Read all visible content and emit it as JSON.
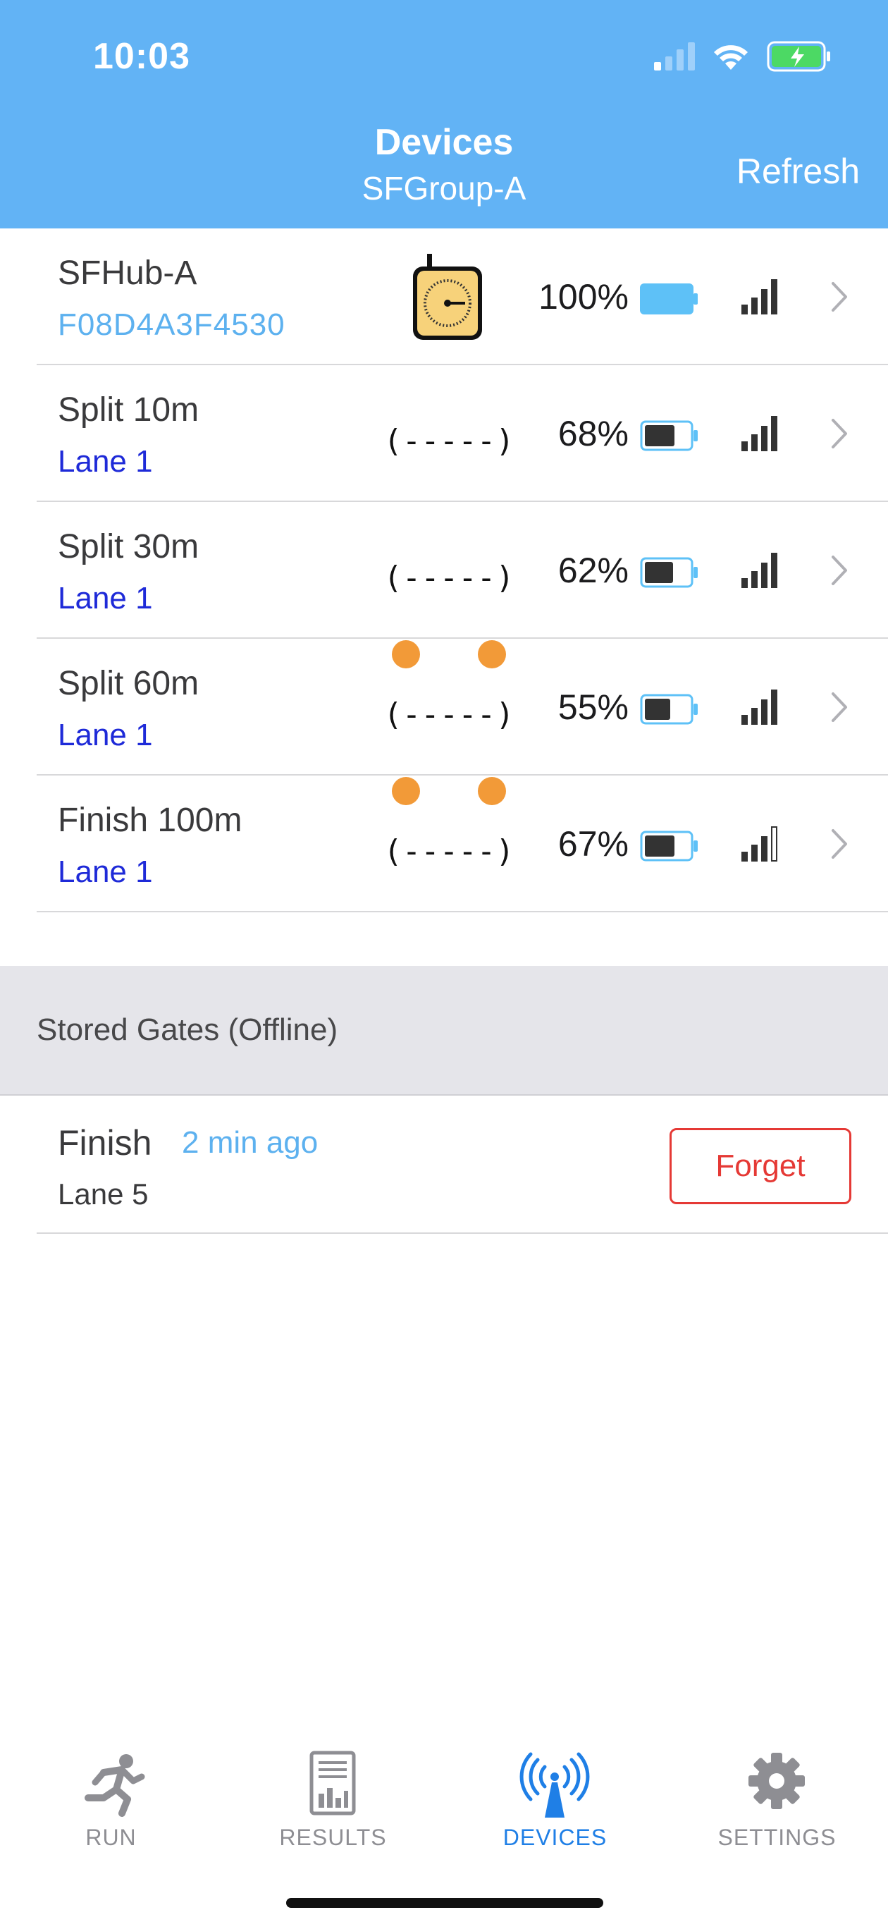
{
  "status_bar": {
    "time": "10:03"
  },
  "nav": {
    "title": "Devices",
    "subtitle": "SFGroup-A",
    "refresh_label": "Refresh"
  },
  "devices": [
    {
      "name": "SFHub-A",
      "sub": "F08D4A3F4530",
      "type": "hub",
      "battery_pct": "100%",
      "battery_level": 1.0,
      "signal_bars": 4,
      "dots": false
    },
    {
      "name": "Split  10m",
      "sub": "Lane 1",
      "type": "gate",
      "gate_glyph": "((-----))",
      "battery_pct": "68%",
      "battery_level": 0.68,
      "signal_bars": 4,
      "dots": false
    },
    {
      "name": "Split  30m",
      "sub": "Lane 1",
      "type": "gate",
      "gate_glyph": "((-----))",
      "battery_pct": "62%",
      "battery_level": 0.62,
      "signal_bars": 4,
      "dots": false
    },
    {
      "name": "Split  60m",
      "sub": "Lane 1",
      "type": "gate",
      "gate_glyph": "((-----))",
      "battery_pct": "55%",
      "battery_level": 0.55,
      "signal_bars": 4,
      "dots": true
    },
    {
      "name": "Finish  100m",
      "sub": "Lane 1",
      "type": "gate",
      "gate_glyph": "((-----))",
      "battery_pct": "67%",
      "battery_level": 0.67,
      "signal_bars": 3,
      "dots": true
    }
  ],
  "stored": {
    "title": "Stored Gates (Offline)",
    "items": [
      {
        "name": "Finish",
        "time": "2 min ago",
        "lane": "Lane 5",
        "forget_label": "Forget"
      }
    ]
  },
  "tabs": [
    {
      "label": "RUN",
      "icon": "runner-icon",
      "active": false
    },
    {
      "label": "RESULTS",
      "icon": "report-icon",
      "active": false
    },
    {
      "label": "DEVICES",
      "icon": "broadcast-icon",
      "active": true
    },
    {
      "label": "SETTINGS",
      "icon": "gear-icon",
      "active": false
    }
  ],
  "colors": {
    "header": "#62b3f5",
    "lane": "#1e2ad8",
    "mac": "#5db1ef",
    "dot": "#f29a38",
    "forget": "#e53935",
    "active_tab": "#1f7fe6"
  }
}
